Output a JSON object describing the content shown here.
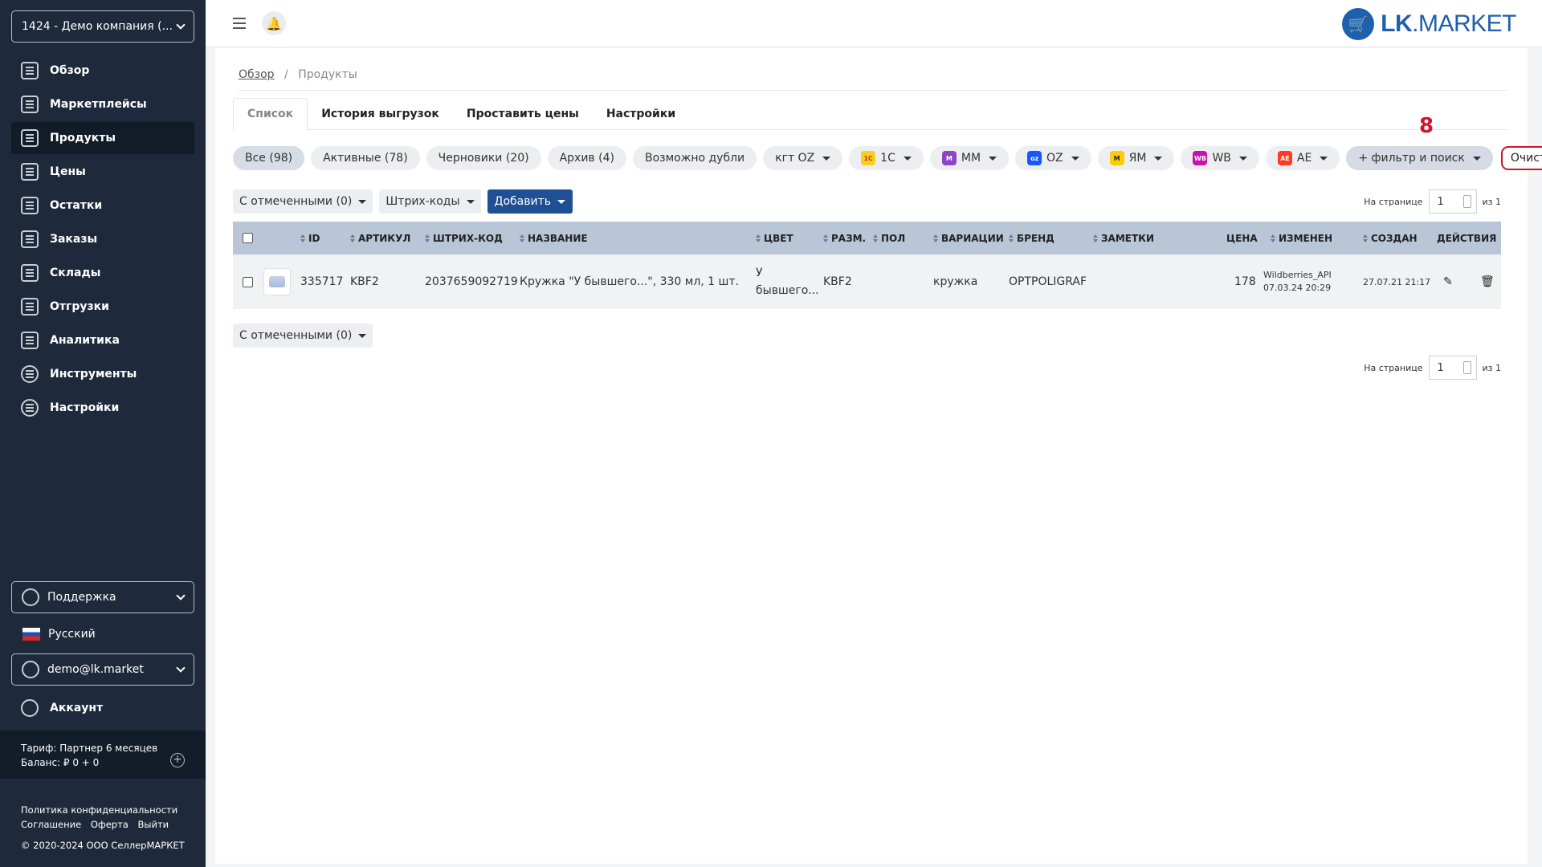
{
  "sidebar": {
    "company": "1424 - Демо компания (...",
    "nav": [
      {
        "label": "Обзор",
        "icon": "dashboard-icon",
        "active": false
      },
      {
        "label": "Маркетплейсы",
        "icon": "marketplace-icon",
        "active": false
      },
      {
        "label": "Продукты",
        "icon": "products-icon",
        "active": true
      },
      {
        "label": "Цены",
        "icon": "price-tag-icon",
        "active": false
      },
      {
        "label": "Остатки",
        "icon": "stock-icon",
        "active": false
      },
      {
        "label": "Заказы",
        "icon": "orders-icon",
        "active": false
      },
      {
        "label": "Склады",
        "icon": "warehouse-icon",
        "active": false
      },
      {
        "label": "Отгрузки",
        "icon": "shipments-icon",
        "active": false
      },
      {
        "label": "Аналитика",
        "icon": "analytics-icon",
        "active": false
      },
      {
        "label": "Инструменты",
        "icon": "tools-icon",
        "active": false
      },
      {
        "label": "Настройки",
        "icon": "settings-icon",
        "active": false
      }
    ],
    "support": "Поддержка",
    "language": "Русский",
    "user": "demo@lk.market",
    "account": "Аккаунт",
    "tariff": "Тариф: Партнер 6 месяцев",
    "balance": "Баланс: ₽ 0 + 0",
    "footer": {
      "privacy": "Политика конфиденциальности",
      "agreement": "Соглашение",
      "offer": "Оферта",
      "logout": "Выйти",
      "copyright": "© 2020-2024 ООО СеллерМАРКЕТ"
    }
  },
  "header": {
    "logo_bold": "LK",
    "logo_rest": ".MARKET"
  },
  "breadcrumb": {
    "root": "Обзор",
    "sep": "/",
    "current": "Продукты"
  },
  "tabs": [
    "Список",
    "История выгрузок",
    "Проставить цены",
    "Настройки"
  ],
  "filters": {
    "all": "Все (98)",
    "active": "Активные (78)",
    "drafts": "Черновики (20)",
    "archive": "Архив (4)",
    "duplicates": "Возможно дубли",
    "ktg": "кгт OZ",
    "mp": [
      {
        "label": "1С",
        "color": "#f7d21c",
        "icon": "1c-icon"
      },
      {
        "label": "ММ",
        "color": "#8e44c9",
        "icon": "megamarket-icon"
      },
      {
        "label": "OZ",
        "color": "#1557ff",
        "icon": "ozon-icon"
      },
      {
        "label": "ЯМ",
        "color": "#ffcc00",
        "icon": "yandex-market-icon"
      },
      {
        "label": "WB",
        "color": "#cb11ab",
        "icon": "wildberries-icon"
      },
      {
        "label": "AE",
        "color": "#ff3a1f",
        "icon": "aliexpress-icon"
      }
    ],
    "filter_search": "+ фильтр и поиск",
    "clear": "Очистить",
    "annotation": "8"
  },
  "toolbar": {
    "selected": "С отмеченными (0)",
    "barcodes": "Штрих-коды",
    "add": "Добавить",
    "per_page_label": "На странице",
    "page_value": "1",
    "of_total": "из 1"
  },
  "table": {
    "headers": {
      "id": "ID",
      "article": "АРТИКУЛ",
      "barcode": "ШТРИХ-КОД",
      "name": "НАЗВАНИЕ",
      "color": "ЦВЕТ",
      "size": "РАЗМ.",
      "gender": "ПОЛ",
      "variations": "ВАРИАЦИИ",
      "brand": "БРЕНД",
      "notes": "ЗАМЕТКИ",
      "price": "ЦЕНА",
      "changed": "ИЗМЕНЕН",
      "created": "СОЗДАН",
      "actions": "ДЕЙСТВИЯ"
    },
    "rows": [
      {
        "id": "335717",
        "article": "KBF2",
        "barcode": "2037659092719",
        "name": "Кружка \"У бывшего...\", 330 мл, 1 шт.",
        "color_line1": "У",
        "color_line2": "бывшего...",
        "size": "KBF2",
        "gender": "",
        "variations": "кружка",
        "brand": "OPTPOLIGRAF",
        "notes": "",
        "price": "178",
        "changed_by": "Wildberries_API",
        "changed_at": "07.03.24 20:29",
        "created": "27.07.21 21:17"
      }
    ]
  }
}
